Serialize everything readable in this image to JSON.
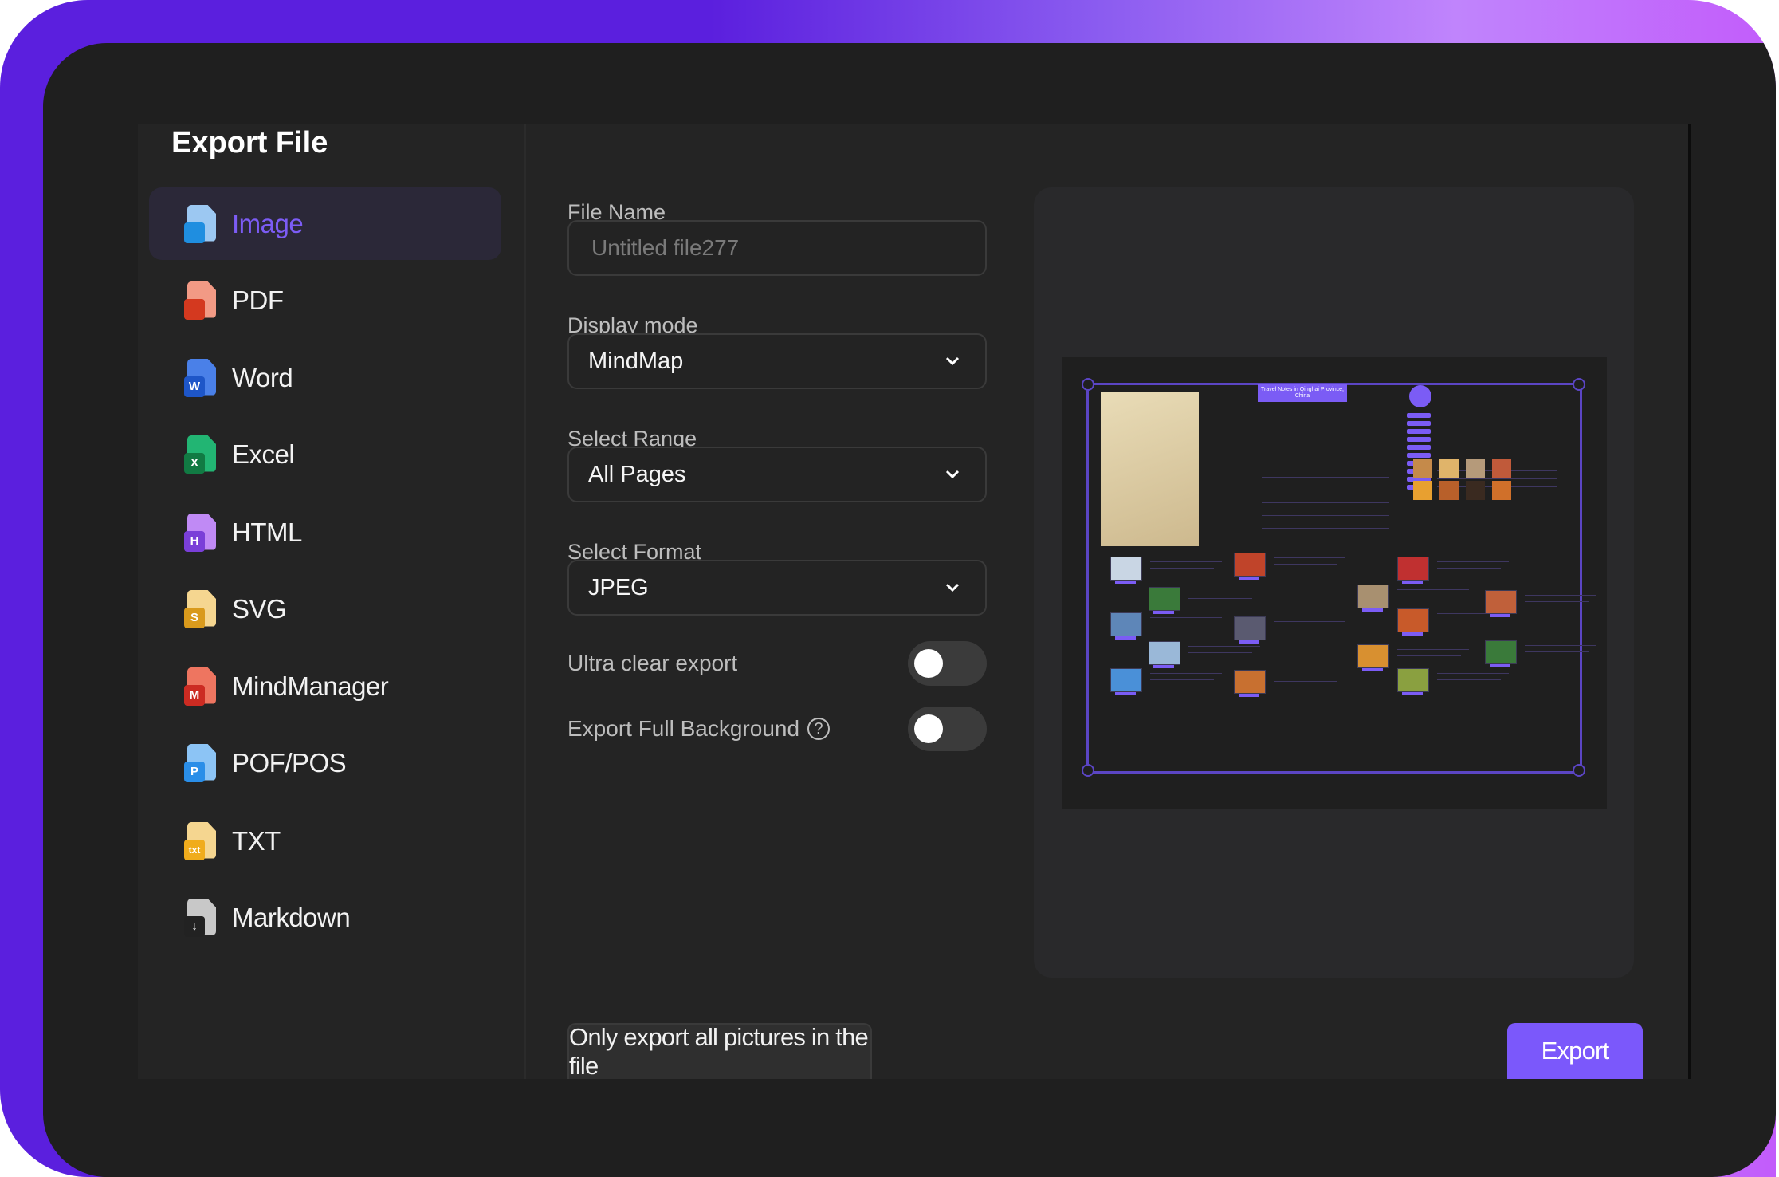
{
  "dialog": {
    "title": "Export File"
  },
  "sidebar": {
    "active_index": 0,
    "items": [
      {
        "label": "Image",
        "icon": "image-file-icon",
        "badge": "",
        "color": "#9cc8f2",
        "badge_color": "#1f8ee0"
      },
      {
        "label": "PDF",
        "icon": "pdf-file-icon",
        "badge": "",
        "color": "#f29a85",
        "badge_color": "#d4391f"
      },
      {
        "label": "Word",
        "icon": "word-file-icon",
        "badge": "W",
        "color": "#4a80e8",
        "badge_color": "#1e56c8"
      },
      {
        "label": "Excel",
        "icon": "excel-file-icon",
        "badge": "X",
        "color": "#22b573",
        "badge_color": "#117a43"
      },
      {
        "label": "HTML",
        "icon": "html-file-icon",
        "badge": "H",
        "color": "#c08af5",
        "badge_color": "#7a3fd8"
      },
      {
        "label": "SVG",
        "icon": "svg-file-icon",
        "badge": "S",
        "color": "#f5d690",
        "badge_color": "#d99a1c"
      },
      {
        "label": "MindManager",
        "icon": "mindmanager-file-icon",
        "badge": "M",
        "color": "#ee7560",
        "badge_color": "#cc2b22"
      },
      {
        "label": "POF/POS",
        "icon": "pof-file-icon",
        "badge": "P",
        "color": "#8cc4f5",
        "badge_color": "#2a8ee8"
      },
      {
        "label": "TXT",
        "icon": "txt-file-icon",
        "badge": "txt",
        "color": "#f5d690",
        "badge_color": "#f0ac1c"
      },
      {
        "label": "Markdown",
        "icon": "markdown-file-icon",
        "badge": "↓",
        "color": "#c8c8c8",
        "badge_color": "#222222"
      }
    ]
  },
  "form": {
    "file_name": {
      "label": "File Name",
      "value": "",
      "placeholder": "Untitled file277"
    },
    "display_mode": {
      "label": "Display mode",
      "value": "MindMap"
    },
    "select_range": {
      "label": "Select Range",
      "value": "All Pages"
    },
    "select_format": {
      "label": "Select Format",
      "value": "JPEG"
    },
    "ultra_clear": {
      "label": "Ultra clear export",
      "enabled": false
    },
    "full_background": {
      "label": "Export Full Background",
      "enabled": false,
      "help": "?"
    }
  },
  "preview": {
    "title": "Travel Notes in Qinghai Province, China"
  },
  "actions": {
    "only_pictures_label": "Only export all pictures in the file",
    "export_label": "Export"
  },
  "colors": {
    "accent": "#7b58fb",
    "active_text": "#7c5cf5",
    "frame_purple": "#5b1fde"
  }
}
